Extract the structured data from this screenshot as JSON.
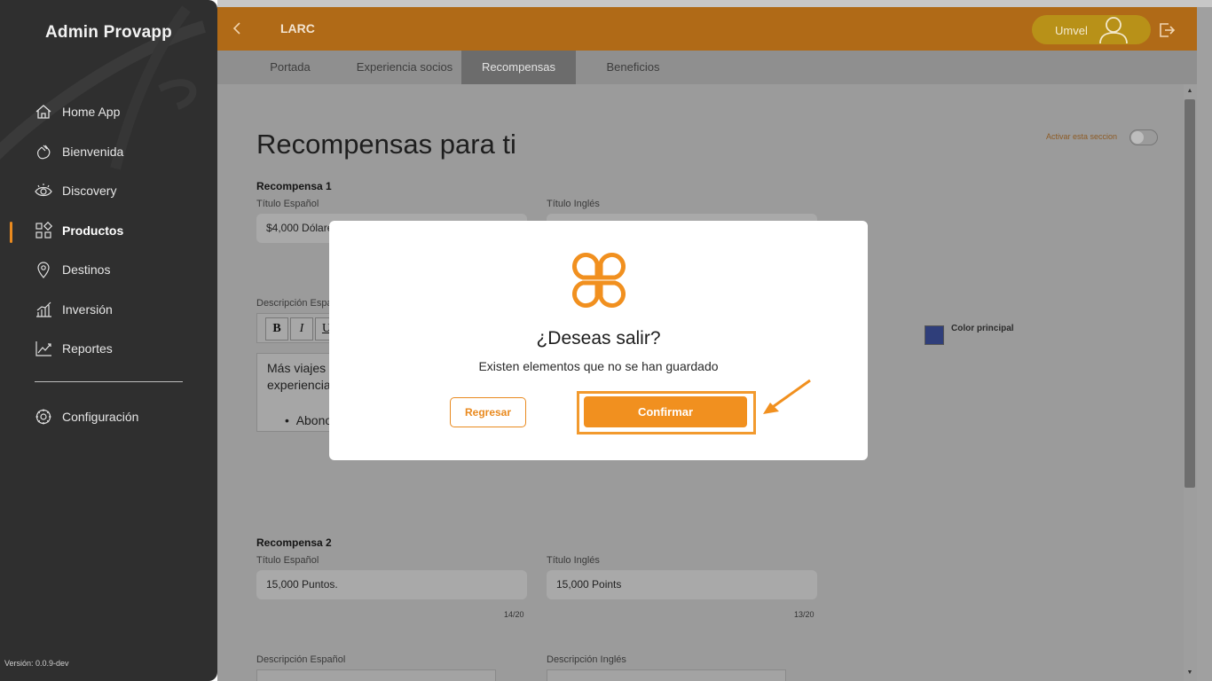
{
  "sidebar": {
    "brand": "Admin Provapp",
    "items": [
      {
        "label": "Home App",
        "icon": "home-icon"
      },
      {
        "label": "Bienvenida",
        "icon": "waving-hand-icon"
      },
      {
        "label": "Discovery",
        "icon": "eye-icon"
      },
      {
        "label": "Productos",
        "icon": "grid-icon",
        "active": true
      },
      {
        "label": "Destinos",
        "icon": "location-pin-icon"
      },
      {
        "label": "Inversión",
        "icon": "bar-chart-icon"
      },
      {
        "label": "Reportes",
        "icon": "line-chart-icon"
      }
    ],
    "settings": {
      "label": "Configuración",
      "icon": "gear-icon"
    },
    "version": "Versión: 0.0.9-dev"
  },
  "header": {
    "title": "LARC",
    "user_name": "Umvel",
    "accent_color": "#b06a17"
  },
  "tabs": [
    {
      "label": "Portada"
    },
    {
      "label": "Experiencia socios"
    },
    {
      "label": "Recompensas",
      "active": true
    },
    {
      "label": "Beneficios"
    }
  ],
  "content": {
    "page_title": "Recompensas para ti",
    "toggle_label": "Activar esta seccion",
    "color_label": "Color principal",
    "color_value": "#2f3e7a",
    "reward1": {
      "label": "Recompensa 1",
      "title_es_label": "Título Español",
      "title_es_value": "$4,000 Dólares",
      "title_en_label": "Título Inglés",
      "desc_es_label": "Descripción Español",
      "desc_text_1": "Más viajes",
      "desc_text_2": "experiencias",
      "desc_bullet": "Abono"
    },
    "reward2": {
      "label": "Recompensa 2",
      "title_es_label": "Título Español",
      "title_es_value": "15,000 Puntos.",
      "title_es_counter": "14/20",
      "title_en_label": "Título Inglés",
      "title_en_value": "15,000 Points",
      "title_en_counter": "13/20",
      "desc_es_label": "Descripción Español",
      "desc_en_label": "Descripción Inglés"
    }
  },
  "modal": {
    "title": "¿Deseas salir?",
    "message": "Existen elementos que no se han guardado",
    "back_label": "Regresar",
    "confirm_label": "Confirmar",
    "accent_color": "#f1901f"
  }
}
